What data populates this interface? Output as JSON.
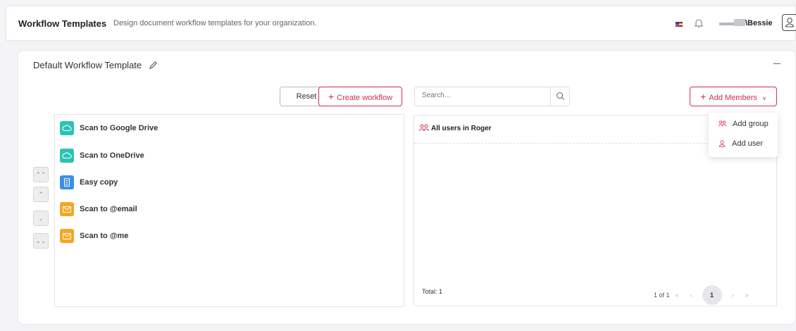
{
  "header": {
    "title": "Workflow Templates",
    "subtitle": "Design document workflow templates for your organization.",
    "account_name": "\\Bessie"
  },
  "template": {
    "title": "Default Workflow Template",
    "reset_label": "Reset",
    "create_label": "Create workflow",
    "workflows": [
      {
        "label": "Scan to Google Drive",
        "icon": "cloud-icon",
        "color": "#2cc3b5"
      },
      {
        "label": "Scan to OneDrive",
        "icon": "cloud-icon",
        "color": "#2cc3b5"
      },
      {
        "label": "Easy copy",
        "icon": "document-icon",
        "color": "#3d8ee8"
      },
      {
        "label": "Scan to @email",
        "icon": "email-icon",
        "color": "#f5a623"
      },
      {
        "label": "Scan to @me",
        "icon": "email-icon",
        "color": "#f5a623"
      }
    ]
  },
  "members": {
    "search_placeholder": "Search...",
    "add_members_label": "Add Members",
    "list": [
      {
        "label": "All users in Roger",
        "icon": "group-icon"
      }
    ],
    "total": "Total: 1",
    "page_info": "1 of 1",
    "current_page": "1",
    "dropdown": [
      {
        "label": "Add group",
        "icon": "group-icon"
      },
      {
        "label": "Add user",
        "icon": "user-icon"
      }
    ]
  },
  "colors": {
    "accent": "#d0314b"
  }
}
